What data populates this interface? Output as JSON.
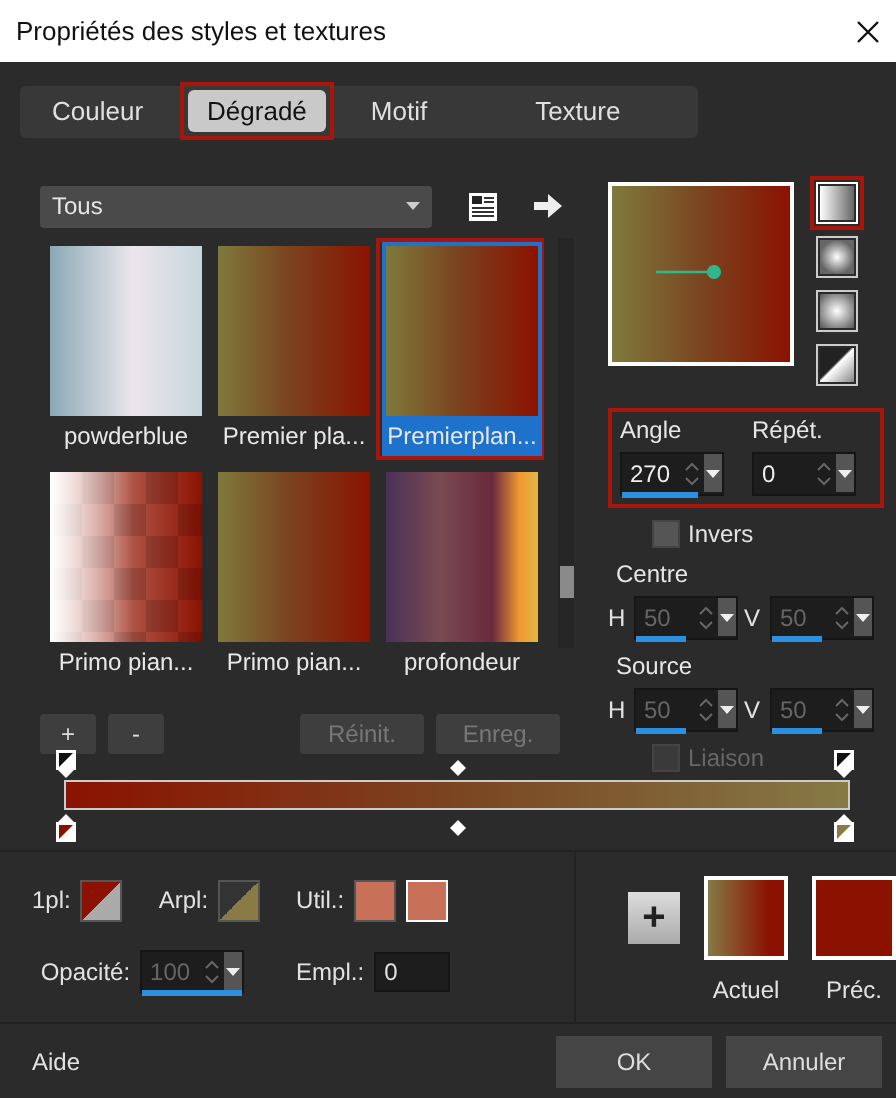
{
  "window": {
    "title": "Propriétés des styles et textures"
  },
  "tabs": [
    {
      "label": "Couleur",
      "selected": false,
      "highlighted": false
    },
    {
      "label": "Dégradé",
      "selected": true,
      "highlighted": true
    },
    {
      "label": "Motif",
      "selected": false,
      "highlighted": false
    },
    {
      "label": "Texture",
      "selected": false,
      "highlighted": false
    }
  ],
  "library": {
    "category": "Tous",
    "gradients": [
      {
        "label": "powderblue",
        "selected": false,
        "highlighted": false
      },
      {
        "label": "Premier pla...",
        "selected": false,
        "highlighted": false
      },
      {
        "label": "Premierplan...",
        "selected": true,
        "highlighted": true
      },
      {
        "label": "Primo pian...",
        "selected": false,
        "highlighted": false
      },
      {
        "label": "Primo pian...",
        "selected": false,
        "highlighted": false
      },
      {
        "label": "profondeur",
        "selected": false,
        "highlighted": false
      }
    ],
    "buttons": [
      {
        "label": "+",
        "disabled": false
      },
      {
        "label": "-",
        "disabled": false
      },
      {
        "label": "Réinit.",
        "disabled": true
      },
      {
        "label": "Enreg.",
        "disabled": true
      }
    ]
  },
  "styles": [
    {
      "kind": "linear",
      "selected": true,
      "highlighted": true
    },
    {
      "kind": "rectangular",
      "selected": false,
      "highlighted": false
    },
    {
      "kind": "radial",
      "selected": false,
      "highlighted": false
    },
    {
      "kind": "corner",
      "selected": false,
      "highlighted": false
    }
  ],
  "angle_repeat": {
    "highlighted": true,
    "fields": [
      {
        "label": "Angle",
        "value": "270",
        "level": 0.75,
        "disabled": false
      },
      {
        "label": "Répét.",
        "value": "0",
        "level": 0,
        "disabled": false
      }
    ]
  },
  "invert": {
    "label": "Invers",
    "checked": false,
    "disabled": false
  },
  "center": {
    "label": "Centre",
    "fields": [
      {
        "axis": "H",
        "value": "50",
        "level": 0.5,
        "disabled": true
      },
      {
        "axis": "V",
        "value": "50",
        "level": 0.5,
        "disabled": true
      }
    ]
  },
  "source": {
    "label": "Source",
    "fields": [
      {
        "axis": "H",
        "value": "50",
        "level": 0.5,
        "disabled": true
      },
      {
        "axis": "V",
        "value": "50",
        "level": 0.5,
        "disabled": true
      }
    ]
  },
  "link": {
    "label": "Liaison",
    "checked": false,
    "disabled": true
  },
  "editor": {
    "foreground": "1pl:",
    "background": "Arpl:",
    "user": "Util.:",
    "opacity": {
      "label": "Opacité:",
      "value": "100",
      "level": 1,
      "disabled": true
    },
    "location": {
      "label": "Empl.:",
      "value": "0"
    }
  },
  "swatches": {
    "add": "+",
    "current": "Actuel",
    "previous": "Préc."
  },
  "footer": {
    "help": "Aide",
    "buttons": [
      "OK",
      "Annuler"
    ]
  }
}
